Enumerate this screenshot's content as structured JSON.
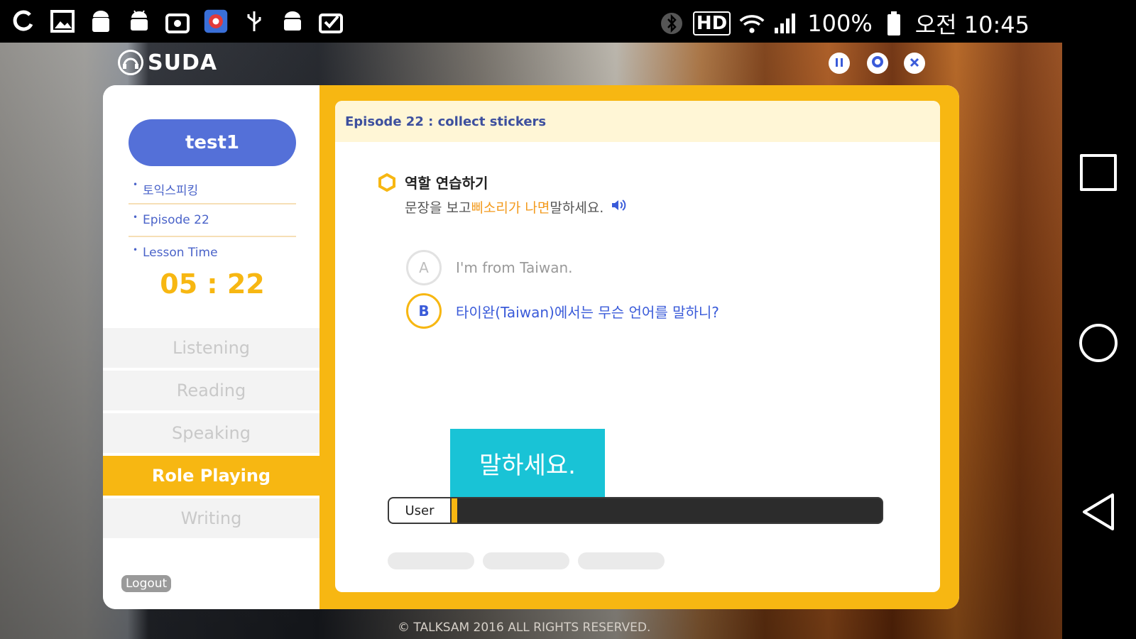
{
  "status_bar": {
    "left_icons": [
      "app-c-icon",
      "gallery-icon",
      "android-icon",
      "android-bot-icon",
      "store-icon",
      "game-icon",
      "usb-icon",
      "android-bot-2-icon",
      "check-box-icon"
    ],
    "battery": "100%",
    "time": "오전 10:45",
    "hd_label": "HD"
  },
  "app": {
    "brand": "SUDA",
    "controls": [
      "pause-icon",
      "settings-icon",
      "close-icon"
    ]
  },
  "sidebar": {
    "user": "test1",
    "course": "토익스피킹",
    "episode": "Episode 22",
    "lesson_time_label": "Lesson Time",
    "timer": "05 : 22",
    "menu": [
      {
        "label": "Listening",
        "active": false
      },
      {
        "label": "Reading",
        "active": false
      },
      {
        "label": "Speaking",
        "active": false
      },
      {
        "label": "Role Playing",
        "active": true
      },
      {
        "label": "Writing",
        "active": false
      }
    ],
    "logout": "Logout"
  },
  "panel": {
    "episode_title": "Episode 22 : collect stickers",
    "task_title": "역할 연습하기",
    "task_desc_before": "문장을 보고 ",
    "task_desc_highlight": "삐소리가 나면",
    "task_desc_after": " 말하세요.",
    "dialog": [
      {
        "badge": "A",
        "text": "I'm from Taiwan."
      },
      {
        "badge": "B",
        "text": "타이완(Taiwan)에서는 무슨 언어를 말하니?"
      }
    ],
    "speak_prompt": "말하세요.",
    "progress_label": "User",
    "progress_value": 0.01
  },
  "footer": {
    "copyright": "© TALKSAM 2016 ALL RIGHTS RESERVED."
  },
  "colors": {
    "accent_yellow": "#f7b712",
    "accent_blue": "#5470d8",
    "speak_cyan": "#19c3d6",
    "highlight_orange": "#f39a1c"
  }
}
